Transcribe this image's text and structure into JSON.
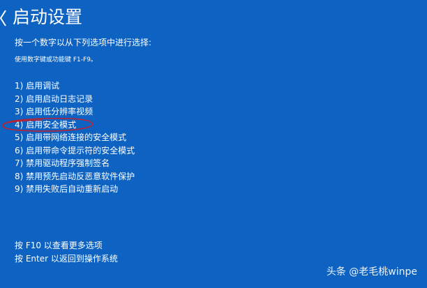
{
  "title": "启动设置",
  "instruction": "按一个数字以从下列选项中进行选择:",
  "hint": "使用数字键或功能键 F1-F9。",
  "options": [
    "1) 启用调试",
    "2) 启用启动日志记录",
    "3) 启用低分辨率视频",
    "4) 启用安全模式",
    "5) 启用带网络连接的安全模式",
    "6) 启用带命令提示符的安全模式",
    "7) 禁用驱动程序强制签名",
    "8) 禁用预先启动反恶意软件保护",
    "9) 禁用失败后自动重新启动"
  ],
  "footer": {
    "more_options": "按 F10 以查看更多选项",
    "return": "按 Enter 以返回到操作系统"
  },
  "watermark": "头条 @老毛桃winpe",
  "icons": {
    "back": "back-arrow-icon",
    "annotation": "red-ellipse-annotation"
  },
  "colors": {
    "background": "#0e63c2",
    "text": "#ffffff",
    "annotation": "#c0202e"
  }
}
